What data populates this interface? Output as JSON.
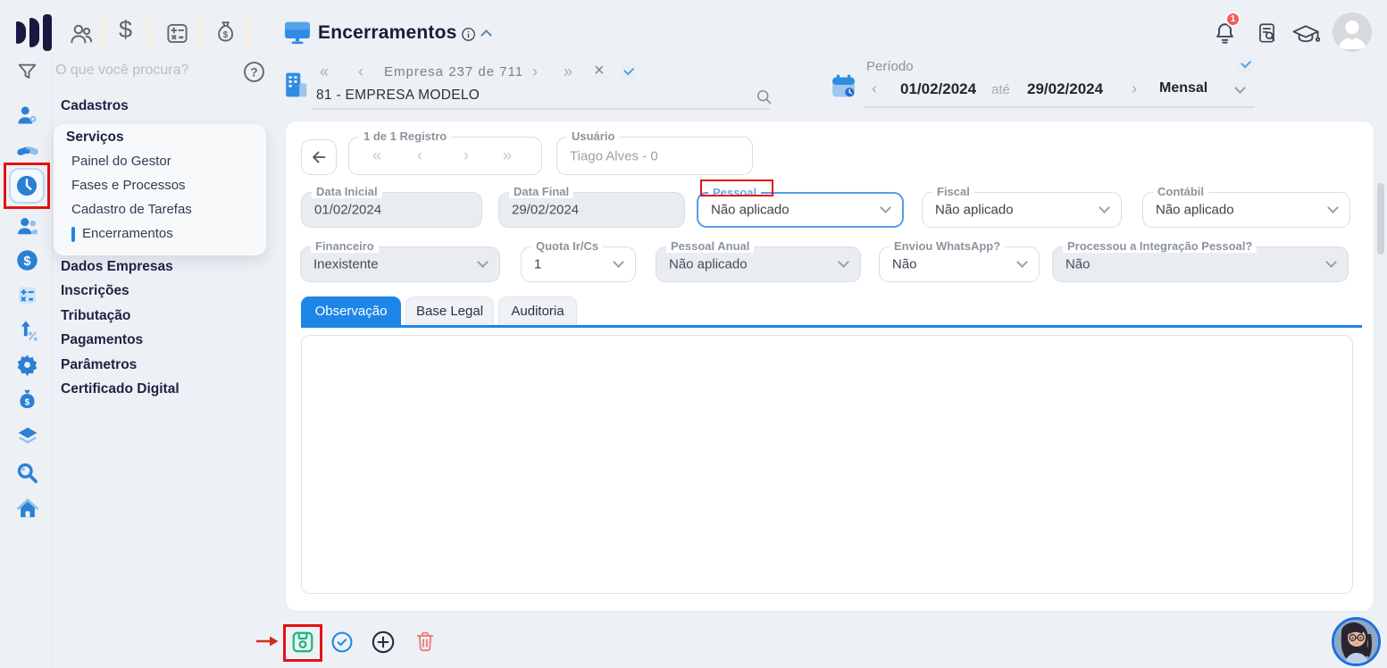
{
  "topbar": {
    "search_placeholder": "O que você procura?",
    "page_title": "Encerramentos",
    "notification_badge": "1"
  },
  "company_nav": {
    "counter": "Empresa 237 de 711",
    "company_name": "81 - EMPRESA MODELO",
    "prev_all": "«",
    "prev": "‹",
    "next": "›",
    "next_all": "»",
    "clear": "×"
  },
  "period": {
    "label": "Período",
    "prev": "‹",
    "start_date": "01/02/2024",
    "separator": "até",
    "end_date": "29/02/2024",
    "next": "›",
    "mode": "Mensal"
  },
  "sidebar": {
    "section_top": "Cadastros",
    "group_title": "Serviços",
    "group_items": [
      "Painel do Gestor",
      "Fases e Processos",
      "Cadastro de Tarefas",
      "Encerramentos"
    ],
    "active_item": "Encerramentos",
    "sections": [
      "Dados Empresas",
      "Inscrições",
      "Tributação",
      "Pagamentos",
      "Parâmetros",
      "Certificado Digital"
    ]
  },
  "form": {
    "record_nav_legend": "1 de 1 Registro",
    "record_prev_all": "«",
    "record_prev": "‹",
    "record_next": "›",
    "record_next_all": "»",
    "user_legend": "Usuário",
    "user_value": "Tiago Alves - 0",
    "fields": [
      {
        "label": "Data Inicial",
        "value": "01/02/2024"
      },
      {
        "label": "Data Final",
        "value": "29/02/2024"
      },
      {
        "label": "Pessoal",
        "value": "Não aplicado"
      },
      {
        "label": "Fiscal",
        "value": "Não aplicado"
      },
      {
        "label": "Contábil",
        "value": "Não aplicado"
      },
      {
        "label": "Financeiro",
        "value": "Inexistente"
      },
      {
        "label": "Quota Ir/Cs",
        "value": "1"
      },
      {
        "label": "Pessoal Anual",
        "value": "Não aplicado"
      },
      {
        "label": "Enviou WhatsApp?",
        "value": "Não"
      },
      {
        "label": "Processou a Integração Pessoal?",
        "value": "Não"
      }
    ],
    "tabs": [
      "Observação",
      "Base Legal",
      "Auditoria"
    ],
    "active_tab": "Observação"
  },
  "colors": {
    "accent": "#1d86e8",
    "annotation_red": "#e31212",
    "save_green": "#17b978",
    "delete_red": "#f27d7d",
    "rail_blue": "#2b80d6"
  }
}
